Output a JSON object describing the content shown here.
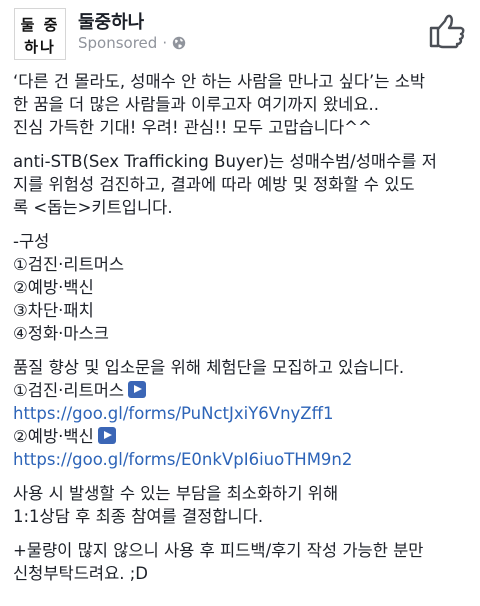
{
  "page": {
    "avatar_line1": "둘 중",
    "avatar_line2": "하나",
    "name": "둘중하나",
    "sponsored": "Sponsored",
    "dot": "·"
  },
  "icons": {
    "privacy": "globe-icon",
    "like": "thumbs-up-icon"
  },
  "post": {
    "intro": [
      "‘다른 건 몰라도, 성매수 안 하는 사람을 만나고 싶다’는 소박",
      "한 꿈을 더 많은 사람들과 이루고자 여기까지 왔네요..",
      "진심 가득한 기대! 우려! 관심!! 모두 고맙습니다^^"
    ],
    "desc": [
      "anti-STB(Sex Trafficking Buyer)는 성매수범/성매수를 저",
      "지를 위험성 검진하고, 결과에 따라 예방 및 정화할 수 있도",
      "록 <돕는>키트입니다."
    ],
    "composition": {
      "heading": "-구성",
      "items": [
        "①검진·리트머스",
        "②예방·백신",
        "③차단·패치",
        "④정화·마스크"
      ]
    },
    "recruit": {
      "text": "품질 향상 및 입소문을 위해 체험단을 모집하고 있습니다.",
      "items": [
        {
          "label": "①검진·리트머스",
          "url": "https://goo.gl/forms/PuNctJxiY6VnyZff1"
        },
        {
          "label": "②예방·백신",
          "url": "https://goo.gl/forms/E0nkVpI6iuoTHM9n2"
        }
      ]
    },
    "burden": [
      "사용 시 발생할 수 있는 부담을 최소화하기 위해",
      "1:1상담 후 최종 참여를 결정합니다."
    ],
    "note": [
      "+물량이 많지 않으니 사용 후 피드백/후기 작성 가능한 분만",
      "신청부탁드려요. ;D"
    ]
  },
  "colors": {
    "link": "#2d64b8",
    "play_button": "#3b66b6",
    "meta_gray": "#90949c"
  }
}
